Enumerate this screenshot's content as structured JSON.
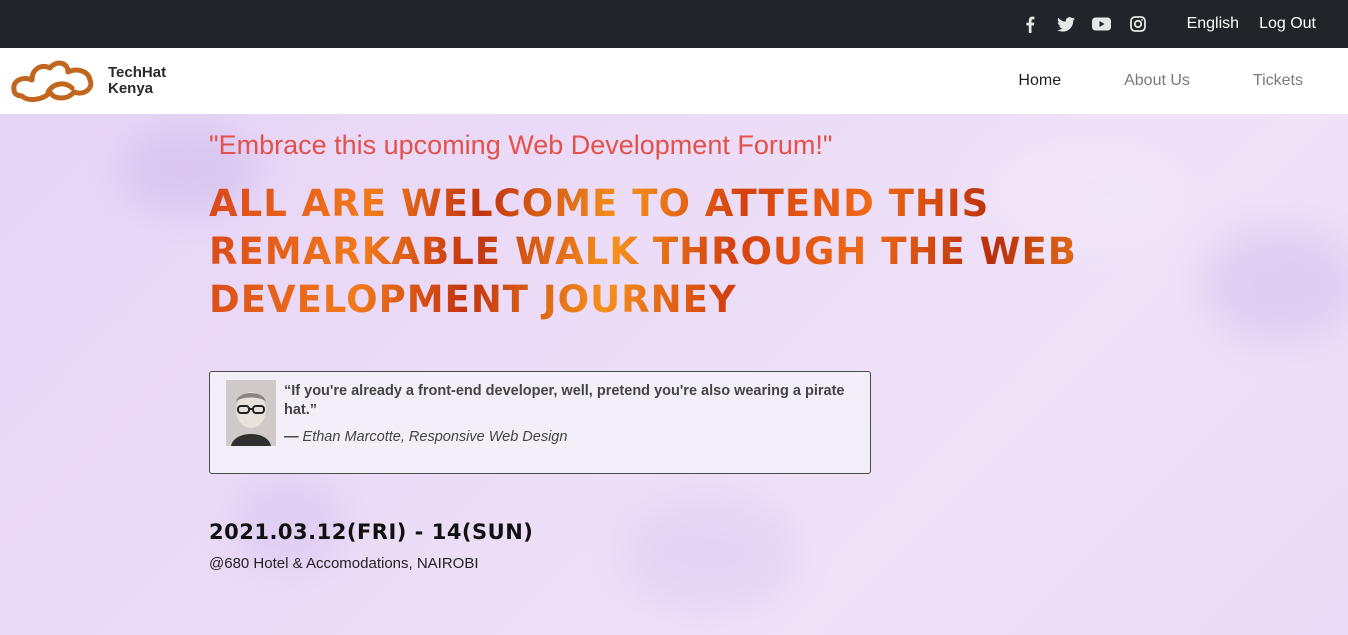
{
  "topbar": {
    "social": [
      "facebook-icon",
      "twitter-icon",
      "youtube-icon",
      "instagram-icon"
    ],
    "language": "English",
    "logout": "Log Out"
  },
  "brand": {
    "line1": "TechHat",
    "line2": "Kenya",
    "logo_color": "#c0661f"
  },
  "nav": {
    "items": [
      {
        "label": "Home",
        "active": true
      },
      {
        "label": "About Us",
        "active": false
      },
      {
        "label": "Tickets",
        "active": false
      }
    ]
  },
  "hero": {
    "subtitle": "\"Embrace this upcoming Web Development Forum!\"",
    "headline": "All are welcome to attend this remarkable walk through the web development journey",
    "quote": {
      "text": "“If you're already a front-end developer, well, pretend you're also wearing a pirate hat.”",
      "dash": "—",
      "author": "Ethan Marcotte, Responsive Web Design"
    },
    "date": "2021.03.12(FRI) - 14(SUN)",
    "venue": "@680 Hotel & Accomodations, NAIROBI"
  },
  "colors": {
    "topbar_bg": "#212428",
    "subtitle": "#e3514b",
    "headline_accent": "#f27a1a",
    "hero_bg": "#ecdcf7"
  }
}
